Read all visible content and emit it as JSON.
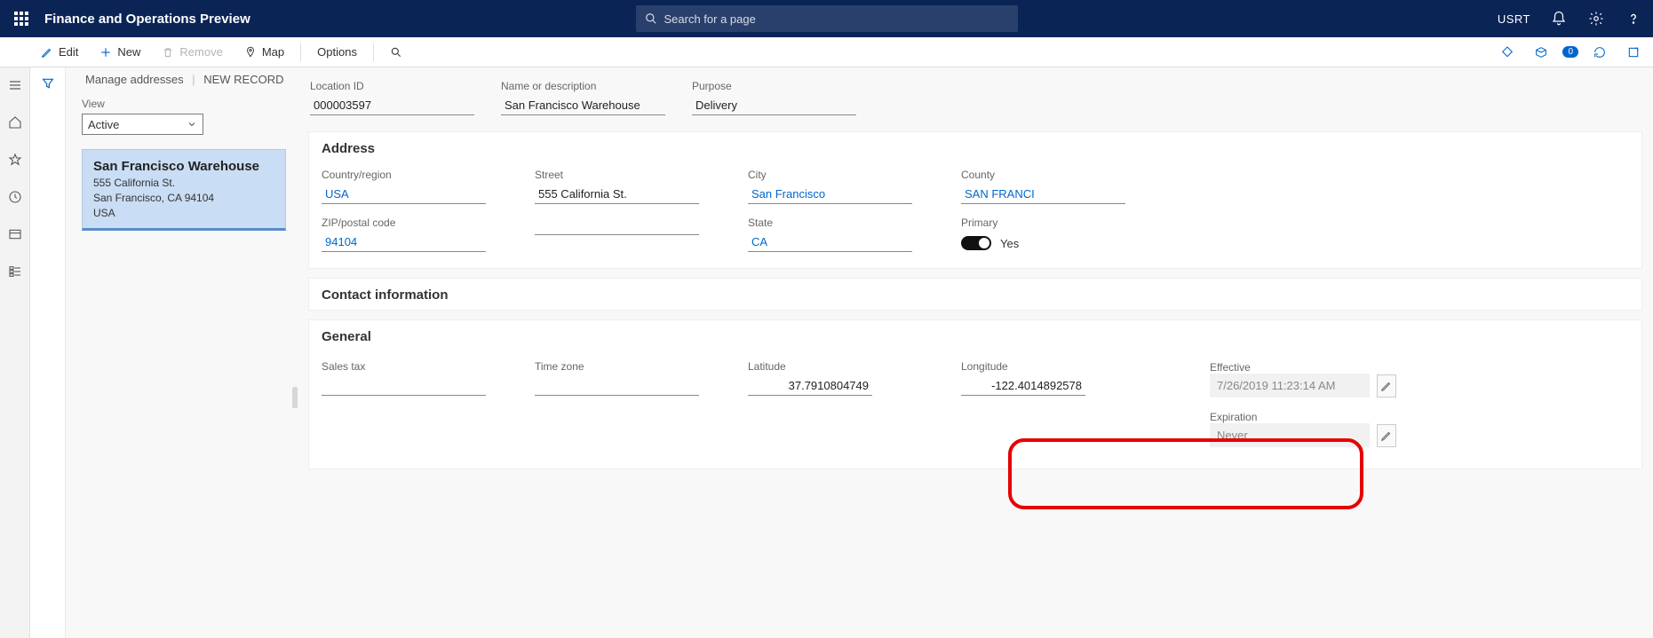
{
  "header": {
    "app_title": "Finance and Operations Preview",
    "search_placeholder": "Search for a page",
    "user_code": "USRT"
  },
  "actionbar": {
    "edit": "Edit",
    "new": "New",
    "remove": "Remove",
    "map": "Map",
    "options": "Options",
    "badge": "0"
  },
  "breadcrumb": {
    "root": "Manage addresses",
    "current": "NEW RECORD"
  },
  "listpane": {
    "view_label": "View",
    "view_value": "Active",
    "card": {
      "title": "San Francisco Warehouse",
      "line1": "555 California St.",
      "line2": "San Francisco, CA 94104",
      "line3": "USA"
    }
  },
  "record_header": {
    "location_id_label": "Location ID",
    "location_id": "000003597",
    "name_label": "Name or description",
    "name": "San Francisco Warehouse",
    "purpose_label": "Purpose",
    "purpose": "Delivery"
  },
  "address": {
    "section_title": "Address",
    "country_label": "Country/region",
    "country": "USA",
    "zip_label": "ZIP/postal code",
    "zip": "94104",
    "street_label": "Street",
    "street": "555 California St.",
    "city_label": "City",
    "city": "San Francisco",
    "state_label": "State",
    "state": "CA",
    "county_label": "County",
    "county": "SAN FRANCI",
    "primary_label": "Primary",
    "primary_value": "Yes"
  },
  "contact": {
    "section_title": "Contact information"
  },
  "general": {
    "section_title": "General",
    "sales_tax_label": "Sales tax",
    "time_zone_label": "Time zone",
    "latitude_label": "Latitude",
    "latitude": "37.7910804749",
    "longitude_label": "Longitude",
    "longitude": "-122.4014892578",
    "effective_label": "Effective",
    "effective": "7/26/2019 11:23:14 AM",
    "expiration_label": "Expiration",
    "expiration": "Never"
  }
}
